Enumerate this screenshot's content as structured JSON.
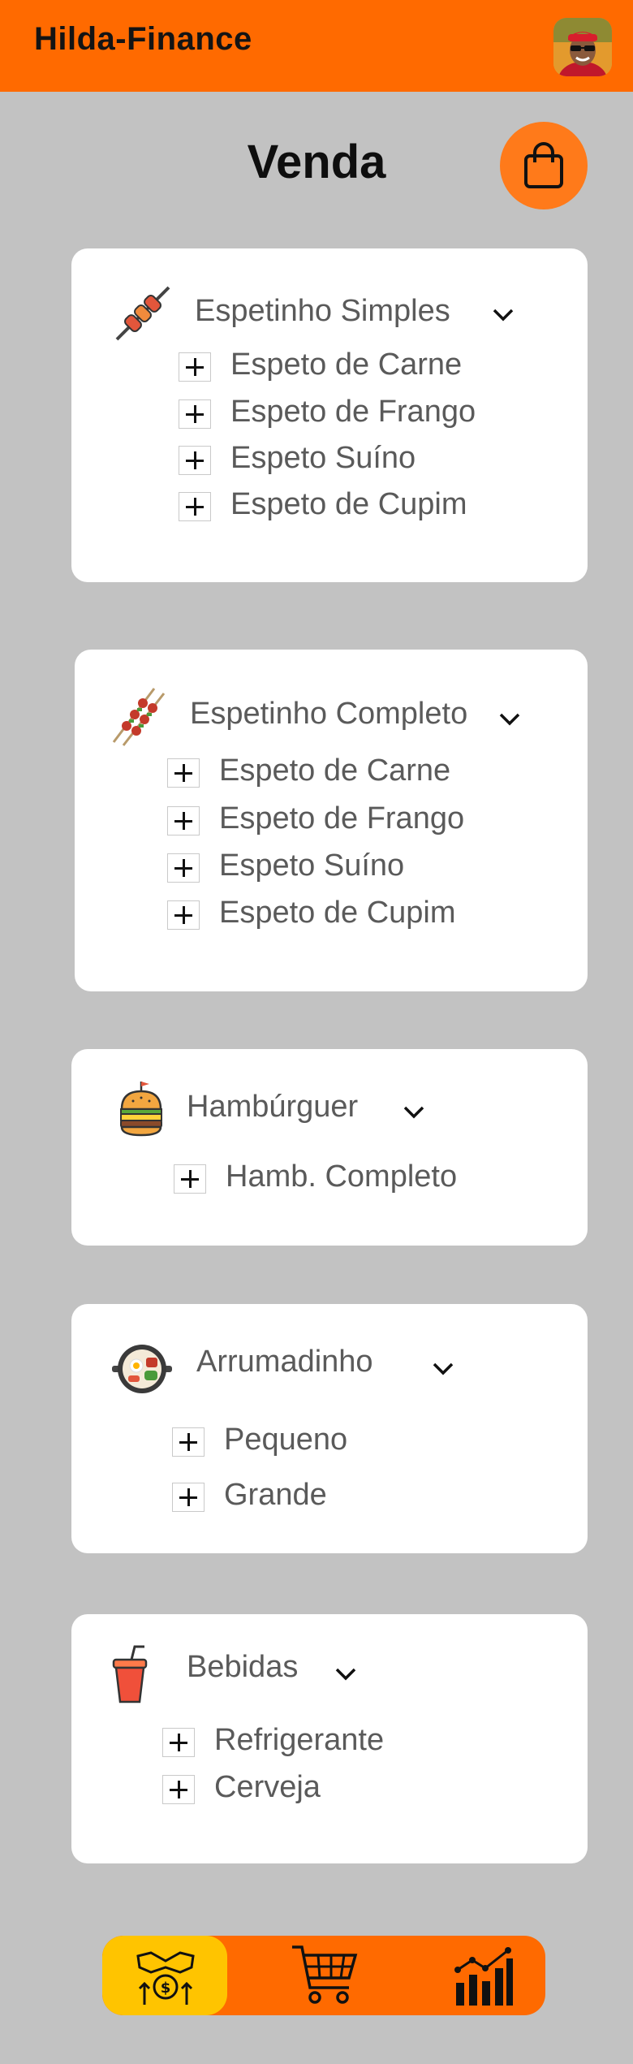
{
  "app": {
    "title": "Hilda-Finance"
  },
  "page": {
    "title": "Venda"
  },
  "colors": {
    "accent": "#ff6a00",
    "active_nav": "#ffc400",
    "background": "#c2c2c2",
    "card": "#ffffff"
  },
  "categories": [
    {
      "name": "Espetinho Simples",
      "icon": "skewer-icon",
      "items": [
        "Espeto de Carne",
        "Espeto de Frango",
        "Espeto Suíno",
        "Espeto de Cupim"
      ]
    },
    {
      "name": "Espetinho Completo",
      "icon": "double-skewer-icon",
      "items": [
        "Espeto de Carne",
        "Espeto de Frango",
        "Espeto Suíno",
        "Espeto de Cupim"
      ]
    },
    {
      "name": "Hambúrguer",
      "icon": "burger-icon",
      "items": [
        "Hamb. Completo"
      ]
    },
    {
      "name": "Arrumadinho",
      "icon": "pan-dish-icon",
      "items": [
        "Pequeno",
        "Grande"
      ]
    },
    {
      "name": "Bebidas",
      "icon": "soda-cup-icon",
      "items": [
        "Refrigerante",
        "Cerveja"
      ]
    }
  ],
  "nav": [
    {
      "icon": "handshake-money-icon",
      "active": true
    },
    {
      "icon": "shopping-cart-icon",
      "active": false
    },
    {
      "icon": "bar-chart-icon",
      "active": false
    }
  ]
}
